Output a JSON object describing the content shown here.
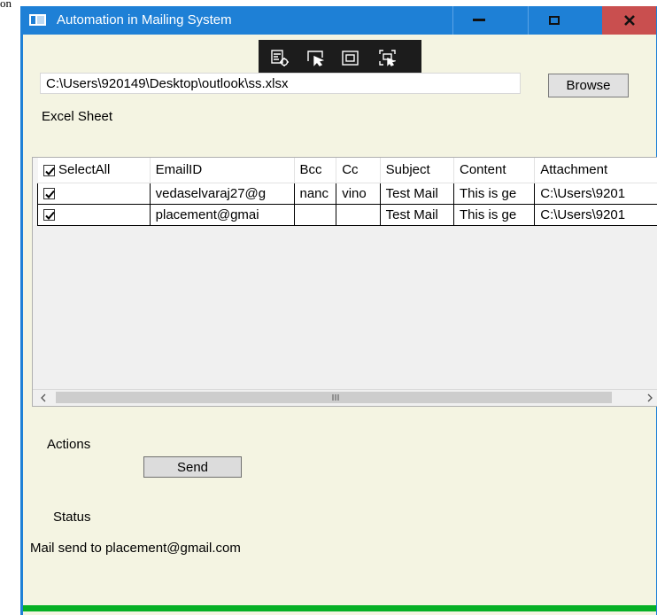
{
  "top_fragment": "on",
  "window": {
    "title": "Automation in Mailing System",
    "minimize_icon": "minimize-icon",
    "maximize_icon": "maximize-icon",
    "close_icon": "close-icon",
    "title_bar_color": "#1e80d6",
    "close_button_color": "#c94f4f",
    "background_color": "#f4f4e2"
  },
  "debug_toolbar": {
    "icons": [
      "live-visual-tree-icon",
      "select-element-icon",
      "display-layout-adorners-icon",
      "track-focused-element-icon"
    ]
  },
  "file_picker": {
    "path_value": "C:\\Users\\920149\\Desktop\\outlook\\ss.xlsx",
    "browse_label": "Browse",
    "section_label": "Excel Sheet"
  },
  "grid": {
    "select_all_label": "SelectAll",
    "columns": [
      "EmailID",
      "Bcc",
      "Cc",
      "Subject",
      "Content",
      "Attachment"
    ],
    "rows": [
      {
        "checked": true,
        "cells": [
          "vedaselvaraj27@g",
          "nanc",
          "vino",
          "Test Mail",
          "This is ge",
          "C:\\Users\\9201"
        ]
      },
      {
        "checked": true,
        "cells": [
          "placement@gmai",
          "",
          "",
          "Test Mail",
          "This is ge",
          "C:\\Users\\9201"
        ]
      }
    ],
    "scroll_left_icon": "chevron-left-icon",
    "scroll_right_icon": "chevron-right-icon",
    "thumb_grip_glyph": "III"
  },
  "actions": {
    "label": "Actions",
    "send_label": "Send"
  },
  "status": {
    "label": "Status",
    "message": "Mail send to placement@gmail.com"
  },
  "progress": {
    "value_fraction": 1.0,
    "color": "#06b025"
  }
}
